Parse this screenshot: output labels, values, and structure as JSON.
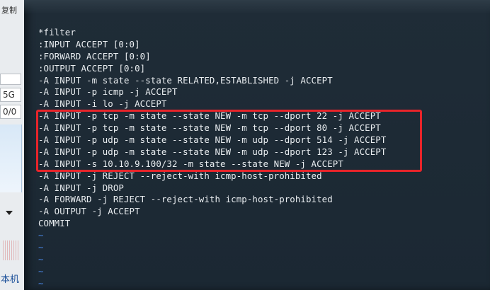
{
  "left_window": {
    "corner_text": "复制",
    "field_1": "5G",
    "field_2": "0/0",
    "bottom_text": "本机"
  },
  "terminal": {
    "lines": [
      "*filter",
      ":INPUT ACCEPT [0:0]",
      ":FORWARD ACCEPT [0:0]",
      ":OUTPUT ACCEPT [0:0]",
      "-A INPUT -m state --state RELATED,ESTABLISHED -j ACCEPT",
      "-A INPUT -p icmp -j ACCEPT",
      "-A INPUT -i lo -j ACCEPT",
      "-A INPUT -p tcp -m state --state NEW -m tcp --dport 22 -j ACCEPT",
      "-A INPUT -p tcp -m state --state NEW -m tcp --dport 80 -j ACCEPT",
      "-A INPUT -p udp -m state --state NEW -m udp --dport 514 -j ACCEPT",
      "-A INPUT -p udp -m state --state NEW -m udp --dport 123 -j ACCEPT",
      "-A INPUT -s 10.10.9.100/32 -m state --state NEW -j ACCEPT",
      "-A INPUT -j REJECT --reject-with icmp-host-prohibited",
      "-A INPUT -j DROP",
      "-A FORWARD -j REJECT --reject-with icmp-host-prohibited",
      "-A OUTPUT -j ACCEPT",
      "COMMIT",
      "~",
      "~",
      "~",
      "~",
      "~"
    ]
  },
  "colors": {
    "terminal_bg": "#1d2a35",
    "text": "#e9edf0",
    "highlight": "#e8242a",
    "tilde": "#3f6fb8"
  }
}
